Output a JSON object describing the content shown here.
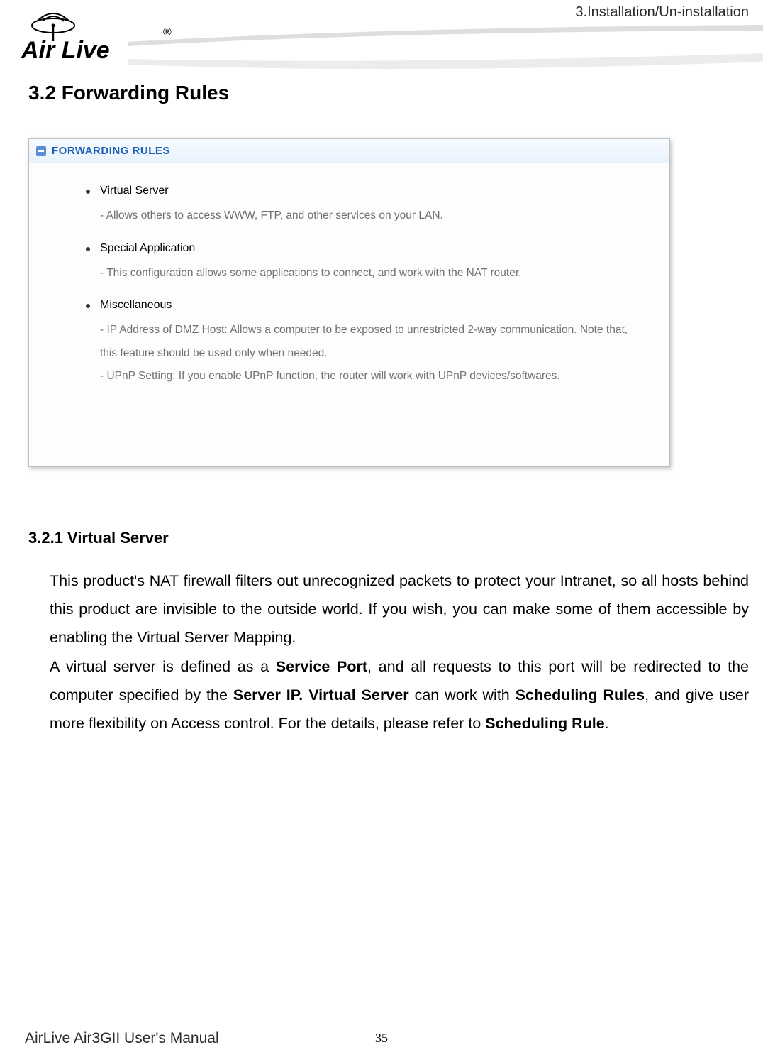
{
  "header_text": "3.Installation/Un-installation",
  "logo": {
    "brand_main": "Air Live",
    "registered": "®"
  },
  "section_title": "3.2 Forwarding Rules",
  "panel": {
    "title": "FORWARDING RULES",
    "items": [
      {
        "title": "Virtual Server",
        "desc": "- Allows others to access WWW, FTP, and other services on your LAN."
      },
      {
        "title": "Special Application",
        "desc": "- This configuration allows some applications to connect, and work with the NAT router."
      },
      {
        "title": "Miscellaneous",
        "desc": "- IP Address of DMZ Host: Allows a computer to be exposed to unrestricted 2-way communication. Note that, this feature should be used only when needed.\n- UPnP Setting: If you enable UPnP function, the router will work with UPnP devices/softwares."
      }
    ]
  },
  "subsection": {
    "title": "3.2.1 Virtual Server",
    "para1_pre": "This product's NAT firewall filters out unrecognized packets to protect your Intranet, so all hosts behind this product are invisible to the outside world. If you wish, you can make some of them accessible by enabling the Virtual Server Mapping.",
    "para2_a": "A virtual server is defined as a ",
    "para2_b": "Service Port",
    "para2_c": ", and all requests to this port will be redirected to the computer specified by the ",
    "para2_d": "Server IP. Virtual Server",
    "para2_e": " can work with ",
    "para2_f": "Scheduling Rules",
    "para2_g": ", and give user more flexibility on Access control. For the details, please refer to ",
    "para2_h": "Scheduling Rule",
    "para2_i": "."
  },
  "footer": {
    "left": "AirLive Air3GII User's Manual",
    "page": "35"
  }
}
